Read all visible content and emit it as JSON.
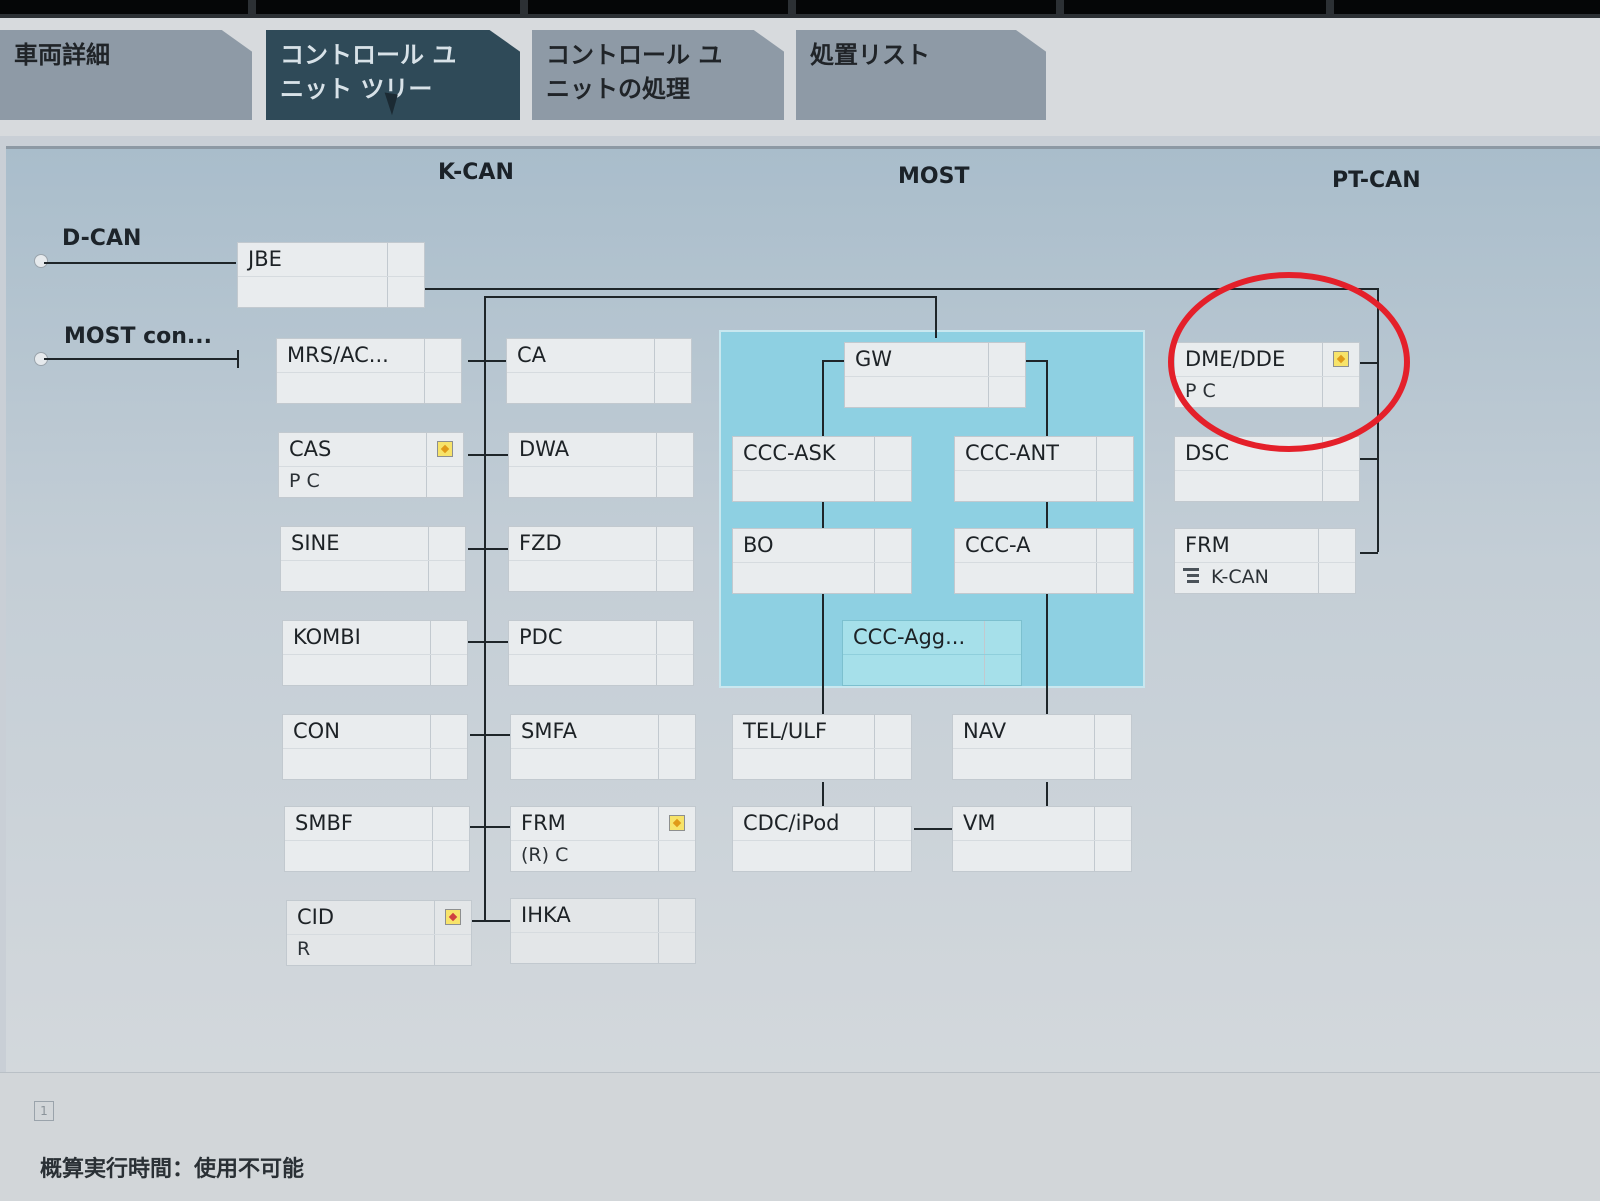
{
  "tabs": [
    {
      "label": "車両詳細",
      "active": false
    },
    {
      "label": "コントロール ユ\nニット ツリー",
      "active": true
    },
    {
      "label": "コントロール ユ\nニットの処理",
      "active": false
    },
    {
      "label": "処置リスト",
      "active": false
    }
  ],
  "buses": {
    "kcan": "K-CAN",
    "most": "MOST",
    "ptcan": "PT-CAN"
  },
  "side": {
    "dcan": "D-CAN",
    "most_con": "MOST con..."
  },
  "nodes": {
    "jbe": {
      "name": "JBE"
    },
    "mrs": {
      "name": "MRS/AC..."
    },
    "cas": {
      "name": "CAS",
      "sub": "P C"
    },
    "sine": {
      "name": "SINE"
    },
    "kombi": {
      "name": "KOMBI"
    },
    "con": {
      "name": "CON"
    },
    "smbf": {
      "name": "SMBF"
    },
    "cid": {
      "name": "CID",
      "sub": "R"
    },
    "ca": {
      "name": "CA"
    },
    "dwa": {
      "name": "DWA"
    },
    "fzd": {
      "name": "FZD"
    },
    "pdc": {
      "name": "PDC"
    },
    "smfa": {
      "name": "SMFA"
    },
    "frm_k": {
      "name": "FRM",
      "sub": "(R) C"
    },
    "ihka": {
      "name": "IHKA"
    },
    "gw": {
      "name": "GW"
    },
    "ccc_ask": {
      "name": "CCC-ASK"
    },
    "ccc_ant": {
      "name": "CCC-ANT"
    },
    "bo": {
      "name": "BO"
    },
    "ccc_a": {
      "name": "CCC-A"
    },
    "ccc_agg": {
      "name": "CCC-Agg..."
    },
    "tel": {
      "name": "TEL/ULF"
    },
    "nav": {
      "name": "NAV"
    },
    "cdc": {
      "name": "CDC/iPod"
    },
    "vm": {
      "name": "VM"
    },
    "dme": {
      "name": "DME/DDE",
      "sub": "P C"
    },
    "dsc": {
      "name": "DSC"
    },
    "frm_pt": {
      "name": "FRM",
      "sub": "K-CAN"
    }
  },
  "status": {
    "text": "概算実行時間：使用不可能",
    "indicator": "1"
  },
  "colors": {
    "active_tab": "#2f4a58",
    "most_region": "#8ed0e2",
    "highlight_ring": "#e4202a",
    "flag": "#f7e36a"
  }
}
